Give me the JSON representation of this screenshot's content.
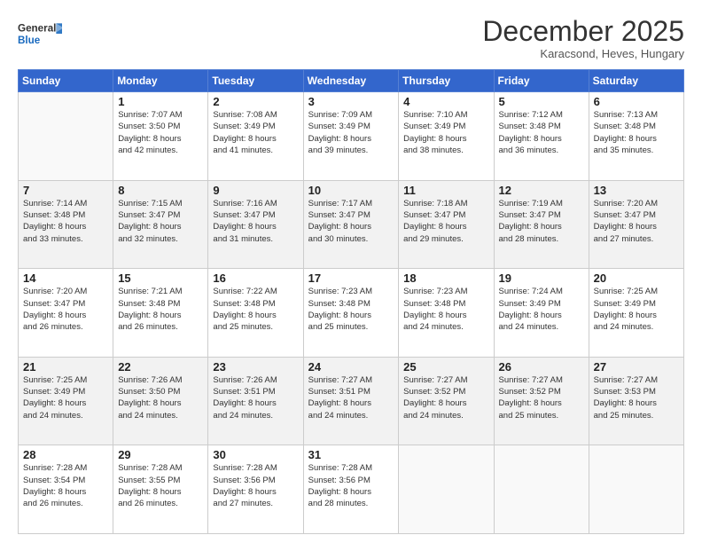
{
  "header": {
    "logo_line1": "General",
    "logo_line2": "Blue",
    "month": "December 2025",
    "location": "Karacsond, Heves, Hungary"
  },
  "weekdays": [
    "Sunday",
    "Monday",
    "Tuesday",
    "Wednesday",
    "Thursday",
    "Friday",
    "Saturday"
  ],
  "weeks": [
    [
      {
        "day": "",
        "info": ""
      },
      {
        "day": "1",
        "info": "Sunrise: 7:07 AM\nSunset: 3:50 PM\nDaylight: 8 hours\nand 42 minutes."
      },
      {
        "day": "2",
        "info": "Sunrise: 7:08 AM\nSunset: 3:49 PM\nDaylight: 8 hours\nand 41 minutes."
      },
      {
        "day": "3",
        "info": "Sunrise: 7:09 AM\nSunset: 3:49 PM\nDaylight: 8 hours\nand 39 minutes."
      },
      {
        "day": "4",
        "info": "Sunrise: 7:10 AM\nSunset: 3:49 PM\nDaylight: 8 hours\nand 38 minutes."
      },
      {
        "day": "5",
        "info": "Sunrise: 7:12 AM\nSunset: 3:48 PM\nDaylight: 8 hours\nand 36 minutes."
      },
      {
        "day": "6",
        "info": "Sunrise: 7:13 AM\nSunset: 3:48 PM\nDaylight: 8 hours\nand 35 minutes."
      }
    ],
    [
      {
        "day": "7",
        "info": "Sunrise: 7:14 AM\nSunset: 3:48 PM\nDaylight: 8 hours\nand 33 minutes."
      },
      {
        "day": "8",
        "info": "Sunrise: 7:15 AM\nSunset: 3:47 PM\nDaylight: 8 hours\nand 32 minutes."
      },
      {
        "day": "9",
        "info": "Sunrise: 7:16 AM\nSunset: 3:47 PM\nDaylight: 8 hours\nand 31 minutes."
      },
      {
        "day": "10",
        "info": "Sunrise: 7:17 AM\nSunset: 3:47 PM\nDaylight: 8 hours\nand 30 minutes."
      },
      {
        "day": "11",
        "info": "Sunrise: 7:18 AM\nSunset: 3:47 PM\nDaylight: 8 hours\nand 29 minutes."
      },
      {
        "day": "12",
        "info": "Sunrise: 7:19 AM\nSunset: 3:47 PM\nDaylight: 8 hours\nand 28 minutes."
      },
      {
        "day": "13",
        "info": "Sunrise: 7:20 AM\nSunset: 3:47 PM\nDaylight: 8 hours\nand 27 minutes."
      }
    ],
    [
      {
        "day": "14",
        "info": "Sunrise: 7:20 AM\nSunset: 3:47 PM\nDaylight: 8 hours\nand 26 minutes."
      },
      {
        "day": "15",
        "info": "Sunrise: 7:21 AM\nSunset: 3:48 PM\nDaylight: 8 hours\nand 26 minutes."
      },
      {
        "day": "16",
        "info": "Sunrise: 7:22 AM\nSunset: 3:48 PM\nDaylight: 8 hours\nand 25 minutes."
      },
      {
        "day": "17",
        "info": "Sunrise: 7:23 AM\nSunset: 3:48 PM\nDaylight: 8 hours\nand 25 minutes."
      },
      {
        "day": "18",
        "info": "Sunrise: 7:23 AM\nSunset: 3:48 PM\nDaylight: 8 hours\nand 24 minutes."
      },
      {
        "day": "19",
        "info": "Sunrise: 7:24 AM\nSunset: 3:49 PM\nDaylight: 8 hours\nand 24 minutes."
      },
      {
        "day": "20",
        "info": "Sunrise: 7:25 AM\nSunset: 3:49 PM\nDaylight: 8 hours\nand 24 minutes."
      }
    ],
    [
      {
        "day": "21",
        "info": "Sunrise: 7:25 AM\nSunset: 3:49 PM\nDaylight: 8 hours\nand 24 minutes."
      },
      {
        "day": "22",
        "info": "Sunrise: 7:26 AM\nSunset: 3:50 PM\nDaylight: 8 hours\nand 24 minutes."
      },
      {
        "day": "23",
        "info": "Sunrise: 7:26 AM\nSunset: 3:51 PM\nDaylight: 8 hours\nand 24 minutes."
      },
      {
        "day": "24",
        "info": "Sunrise: 7:27 AM\nSunset: 3:51 PM\nDaylight: 8 hours\nand 24 minutes."
      },
      {
        "day": "25",
        "info": "Sunrise: 7:27 AM\nSunset: 3:52 PM\nDaylight: 8 hours\nand 24 minutes."
      },
      {
        "day": "26",
        "info": "Sunrise: 7:27 AM\nSunset: 3:52 PM\nDaylight: 8 hours\nand 25 minutes."
      },
      {
        "day": "27",
        "info": "Sunrise: 7:27 AM\nSunset: 3:53 PM\nDaylight: 8 hours\nand 25 minutes."
      }
    ],
    [
      {
        "day": "28",
        "info": "Sunrise: 7:28 AM\nSunset: 3:54 PM\nDaylight: 8 hours\nand 26 minutes."
      },
      {
        "day": "29",
        "info": "Sunrise: 7:28 AM\nSunset: 3:55 PM\nDaylight: 8 hours\nand 26 minutes."
      },
      {
        "day": "30",
        "info": "Sunrise: 7:28 AM\nSunset: 3:56 PM\nDaylight: 8 hours\nand 27 minutes."
      },
      {
        "day": "31",
        "info": "Sunrise: 7:28 AM\nSunset: 3:56 PM\nDaylight: 8 hours\nand 28 minutes."
      },
      {
        "day": "",
        "info": ""
      },
      {
        "day": "",
        "info": ""
      },
      {
        "day": "",
        "info": ""
      }
    ]
  ]
}
